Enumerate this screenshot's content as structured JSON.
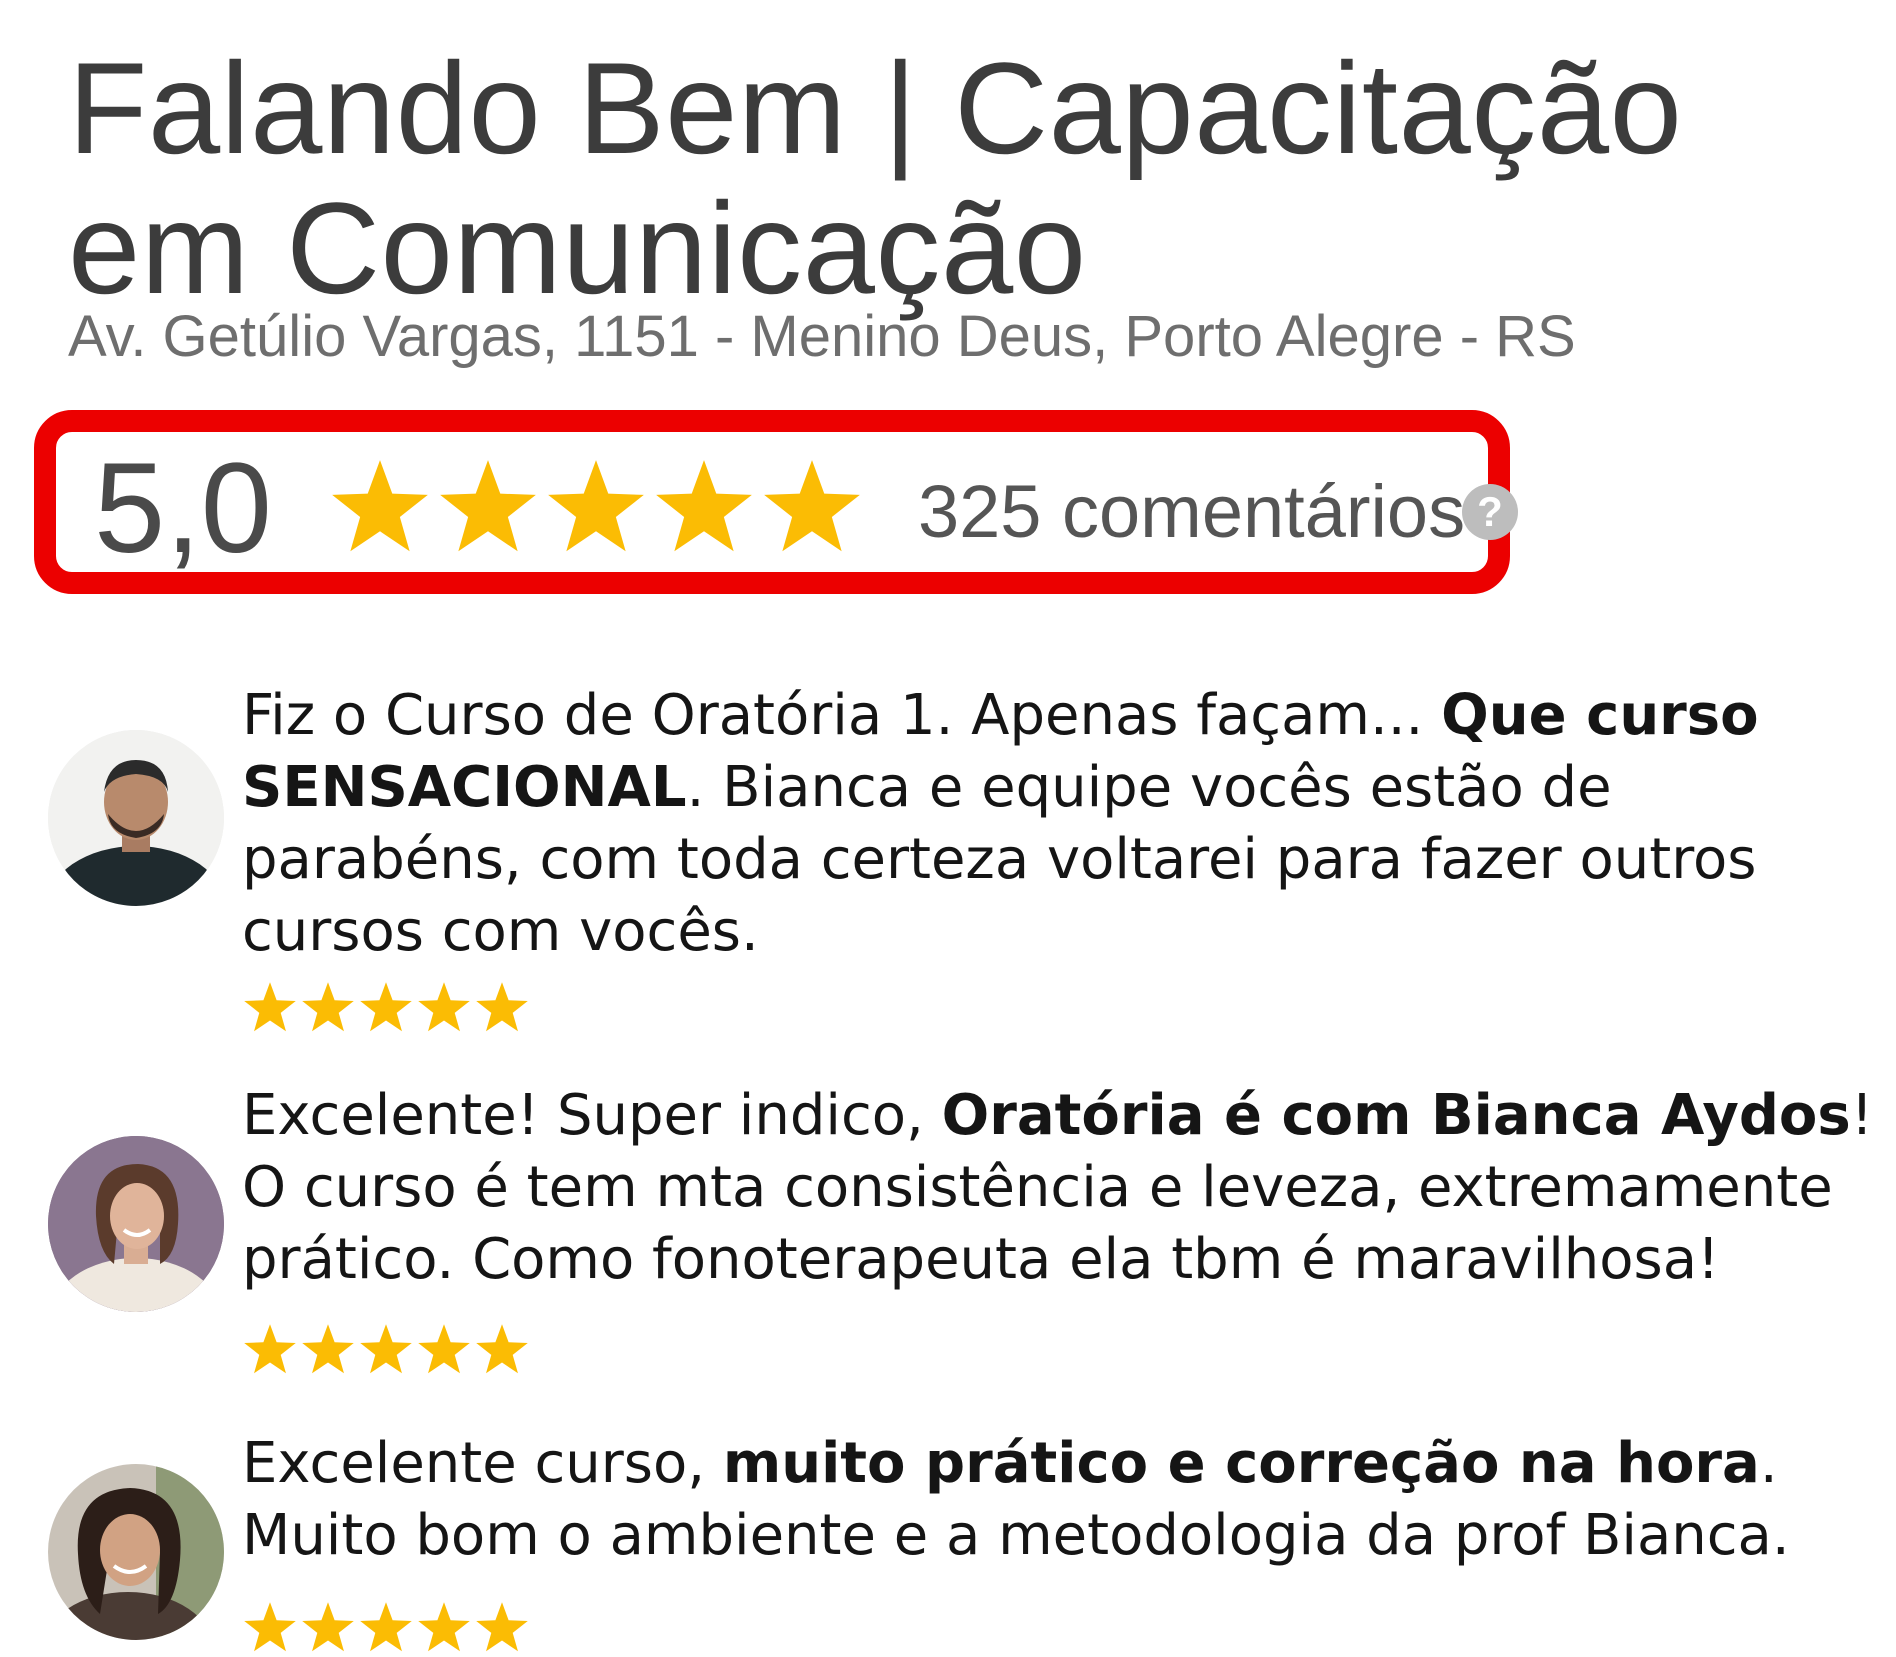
{
  "business": {
    "title": "Falando Bem | Capacitação em Comunicação",
    "address": "Av. Getúlio Vargas, 1151 - Menino Deus, Porto Alegre - RS"
  },
  "rating": {
    "score_text": "5,0",
    "score": 5,
    "max": 5,
    "review_count_text": "325 comentários",
    "help_icon": "help-circle-icon",
    "help_glyph": "?"
  },
  "colors": {
    "star": "#fbbc04",
    "highlight_border": "#ec0000",
    "title": "#3c3c3c",
    "address": "#6e6e6e"
  },
  "reviews": [
    {
      "avatar_icon": "reviewer-avatar-man-icon",
      "segments": [
        {
          "text": "Fiz o Curso de Oratória 1. Apenas façam... ",
          "bold": false
        },
        {
          "text": "Que curso SENSACIONAL",
          "bold": true
        },
        {
          "text": ". Bianca e equipe vocês estão de parabéns, com toda certeza voltarei para fazer outros cursos com vocês.",
          "bold": false
        }
      ],
      "stars": 5
    },
    {
      "avatar_icon": "reviewer-avatar-woman-icon",
      "segments": [
        {
          "text": "Excelente! Super indico, ",
          "bold": false
        },
        {
          "text": "Oratória é com Bianca Aydos",
          "bold": true
        },
        {
          "text": "! O curso é tem mta consistência e leveza, extremamente prático. Como fonoterapeuta ela tbm é maravilhosa!",
          "bold": false
        }
      ],
      "stars": 5
    },
    {
      "avatar_icon": "reviewer-avatar-woman-icon",
      "segments": [
        {
          "text": "Excelente curso, ",
          "bold": false
        },
        {
          "text": "muito prático e correção na hora",
          "bold": true
        },
        {
          "text": ". Muito bom o ambiente e a metodologia da prof Bianca.",
          "bold": false
        }
      ],
      "stars": 5
    }
  ]
}
